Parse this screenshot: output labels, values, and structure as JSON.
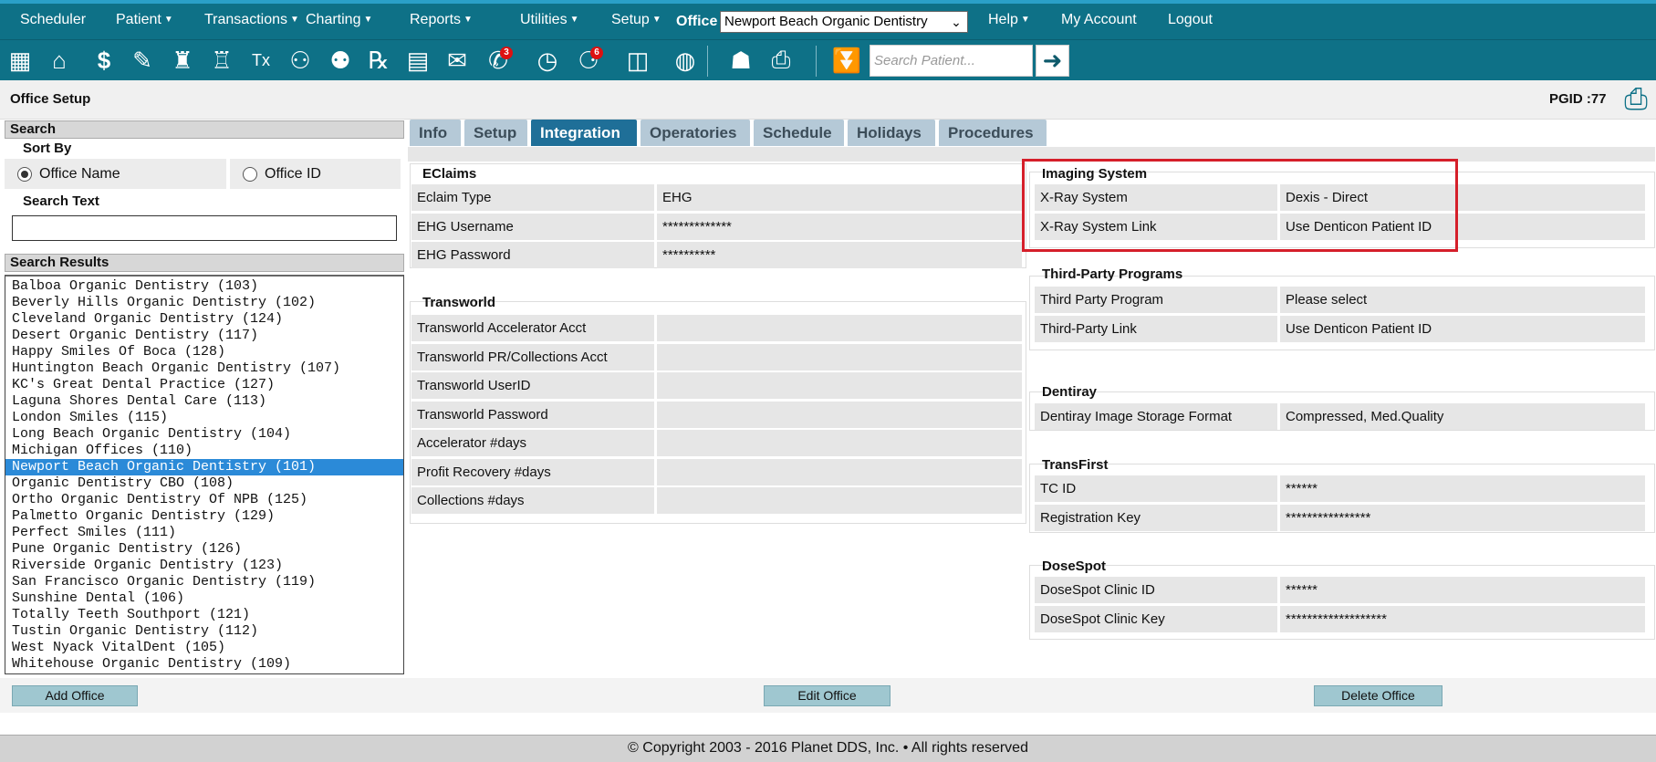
{
  "menu": {
    "items": [
      {
        "label": "Scheduler",
        "caret": false
      },
      {
        "label": "Patient",
        "caret": true
      },
      {
        "label": "Transactions",
        "caret": true
      },
      {
        "label": "Charting",
        "caret": true
      },
      {
        "label": "Reports",
        "caret": true
      },
      {
        "label": "Utilities",
        "caret": true
      },
      {
        "label": "Setup",
        "caret": true
      }
    ],
    "office_label": "Office",
    "office_value": "Newport Beach Organic Dentistry",
    "right_items": [
      {
        "label": "Help",
        "caret": true
      },
      {
        "label": "My Account",
        "caret": false
      },
      {
        "label": "Logout",
        "caret": false
      }
    ]
  },
  "toolbar": {
    "icons": [
      {
        "name": "grid-icon",
        "glyph": "▦"
      },
      {
        "name": "home-icon",
        "glyph": "⌂"
      },
      {
        "name": "dollar-transfer-icon",
        "glyph": "$"
      },
      {
        "name": "edit-list-icon",
        "glyph": "✎"
      },
      {
        "name": "tooth-icon",
        "glyph": "♜"
      },
      {
        "name": "tooth-implant-icon",
        "glyph": "♖"
      },
      {
        "name": "treatment-tx-icon",
        "glyph": "Tx"
      },
      {
        "name": "add-patient-icon",
        "glyph": "⚇"
      },
      {
        "name": "add-family-icon",
        "glyph": "⚉"
      },
      {
        "name": "prescription-icon",
        "glyph": "℞"
      },
      {
        "name": "notepad-icon",
        "glyph": "▤"
      },
      {
        "name": "mail-icon",
        "glyph": "✉"
      },
      {
        "name": "message-icon",
        "glyph": "✆",
        "badge": "3"
      },
      {
        "name": "clock-icon",
        "glyph": "◷"
      },
      {
        "name": "patient-alerts-icon",
        "glyph": "⚆",
        "badge": "6"
      },
      {
        "name": "tooth-frame-icon",
        "glyph": "◫"
      },
      {
        "name": "globe-icon",
        "glyph": "◍"
      },
      {
        "name": "users-icon",
        "glyph": "☗"
      },
      {
        "name": "printer-scan-icon",
        "glyph": "⎙"
      },
      {
        "name": "expand-menu-icon",
        "glyph": "⏬"
      }
    ],
    "search_placeholder": "Search Patient...",
    "search_go_glyph": "➜"
  },
  "header": {
    "title": "Office Setup",
    "pgid": "PGID :77",
    "print_glyph": "⎙"
  },
  "search_panel": {
    "heading": "Search",
    "sort_by_label": "Sort By",
    "sort_options": [
      {
        "label": "Office Name",
        "selected": true
      },
      {
        "label": "Office ID",
        "selected": false
      }
    ],
    "search_text_label": "Search Text",
    "search_text_value": "",
    "results_heading": "Search Results",
    "results": [
      "Balboa Organic Dentistry (103)",
      "Beverly Hills Organic Dentistry (102)",
      "Cleveland Organic Dentistry (124)",
      "Desert Organic Dentistry (117)",
      "Happy Smiles Of Boca (128)",
      "Huntington Beach Organic Dentistry (107)",
      "KC's Great Dental Practice (127)",
      "Laguna Shores Dental Care (113)",
      "London Smiles (115)",
      "Long Beach Organic Dentistry (104)",
      "Michigan Offices (110)",
      "Newport Beach Organic Dentistry (101)",
      "Organic Dentistry CBO (108)",
      "Ortho Organic Dentistry Of NPB (125)",
      "Palmetto Organic Dentistry (129)",
      "Perfect Smiles (111)",
      "Pune Organic Dentistry (126)",
      "Riverside Organic Dentistry (123)",
      "San Francisco Organic Dentistry (119)",
      "Sunshine Dental (106)",
      "Totally Teeth Southport (121)",
      "Tustin Organic Dentistry (112)",
      "West Nyack VitalDent (105)",
      "Whitehouse Organic Dentistry (109)"
    ],
    "selected_index": 11
  },
  "tabs": [
    {
      "label": "Info",
      "active": false
    },
    {
      "label": "Setup",
      "active": false
    },
    {
      "label": "Integration",
      "active": true
    },
    {
      "label": "Operatories",
      "active": false
    },
    {
      "label": "Schedule",
      "active": false
    },
    {
      "label": "Holidays",
      "active": false
    },
    {
      "label": "Procedures",
      "active": false
    }
  ],
  "sections": {
    "eclaims": {
      "title": "EClaims",
      "rows": [
        {
          "label": "Eclaim Type",
          "value": "EHG"
        },
        {
          "label": "EHG Username",
          "value": "*************"
        },
        {
          "label": "EHG Password",
          "value": "**********"
        }
      ]
    },
    "transworld": {
      "title": "Transworld",
      "rows": [
        {
          "label": "Transworld Accelerator Acct",
          "value": ""
        },
        {
          "label": "Transworld PR/Collections Acct",
          "value": ""
        },
        {
          "label": "Transworld UserID",
          "value": ""
        },
        {
          "label": "Transworld Password",
          "value": ""
        },
        {
          "label": "Accelerator #days",
          "value": ""
        },
        {
          "label": "Profit Recovery #days",
          "value": ""
        },
        {
          "label": "Collections #days",
          "value": ""
        }
      ]
    },
    "imaging": {
      "title": "Imaging System",
      "rows": [
        {
          "label": "X-Ray System",
          "value": "Dexis - Direct"
        },
        {
          "label": "X-Ray System Link",
          "value": "Use Denticon Patient ID"
        }
      ]
    },
    "third_party": {
      "title": "Third-Party Programs",
      "rows": [
        {
          "label": "Third Party Program",
          "value": "Please select"
        },
        {
          "label": "Third-Party Link",
          "value": "Use Denticon Patient ID"
        }
      ]
    },
    "dentiray": {
      "title": "Dentiray",
      "rows": [
        {
          "label": "Dentiray Image Storage Format",
          "value": "Compressed, Med.Quality"
        }
      ]
    },
    "transfirst": {
      "title": "TransFirst",
      "rows": [
        {
          "label": "TC ID",
          "value": "******"
        },
        {
          "label": "Registration Key",
          "value": "****************"
        }
      ]
    },
    "dosespot": {
      "title": "DoseSpot",
      "rows": [
        {
          "label": "DoseSpot Clinic ID",
          "value": "******"
        },
        {
          "label": "DoseSpot Clinic Key",
          "value": "*******************"
        }
      ]
    }
  },
  "buttons": {
    "add": "Add Office",
    "edit": "Edit Office",
    "delete": "Delete Office"
  },
  "footer": {
    "text": "© Copyright 2003 - 2016 Planet DDS, Inc. • All rights reserved"
  },
  "colors": {
    "menu_bg": "#0e7187",
    "tab_active": "#1f6f98",
    "tab_inactive": "#b5c9d7",
    "highlight": "#d51f2a",
    "selected_row": "#2b8ad8"
  }
}
